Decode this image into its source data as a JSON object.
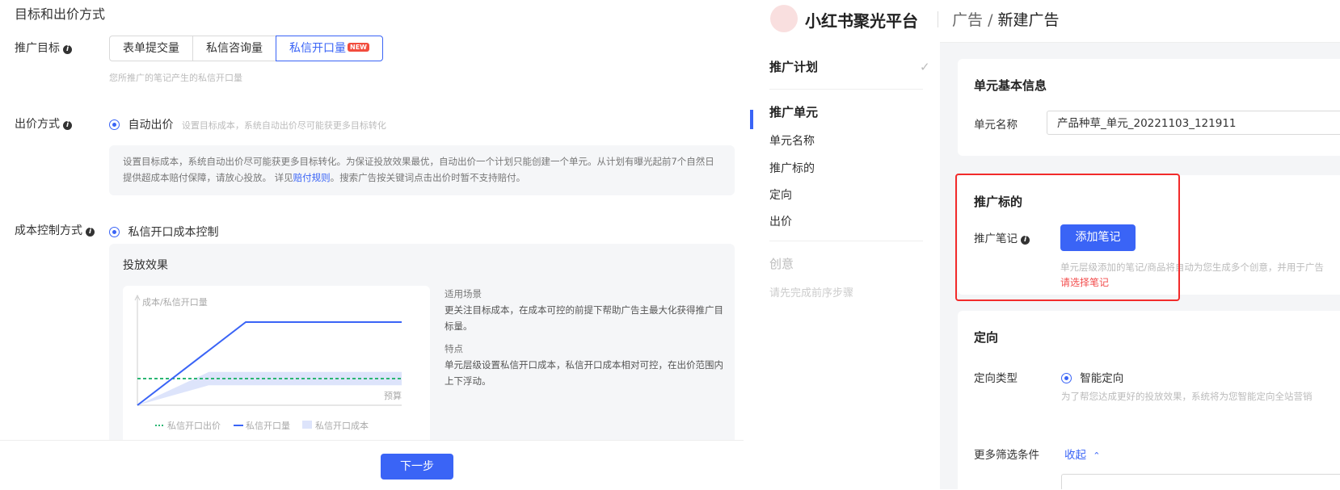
{
  "left": {
    "section_title": "目标和出价方式",
    "goal": {
      "label": "推广目标",
      "tabs": [
        "表单提交量",
        "私信咨询量",
        "私信开口量"
      ],
      "new_badge": "NEW",
      "hint": "您所推广的笔记产生的私信开口量"
    },
    "bid": {
      "label": "出价方式",
      "option": "自动出价",
      "option_hint": "设置目标成本，系统自动出价尽可能获更多目标转化",
      "desc_line1": "设置目标成本，系统自动出价尽可能获更多目标转化。为保证投放效果最优，自动出价一个计划只能创建一个单元。从计划有曝光起前7个自然日",
      "desc_line2_a": "提供超成本赔付保障，请放心投放。 详见",
      "desc_line2_link": "赔付规则",
      "desc_line2_b": "。搜索广告按关键词点击出价时暂不支持赔付。"
    },
    "cost": {
      "label": "成本控制方式",
      "option": "私信开口成本控制",
      "effect_title": "投放效果",
      "y_axis_label": "成本/私信开口量",
      "x_axis_label": "预算",
      "legend": [
        "私信开口出价",
        "私信开口量",
        "私信开口成本"
      ],
      "scene_title": "适用场景",
      "scene_text_1": "更关注目标成本，在成本可控的前提下帮助广告主最大化获得推广目",
      "scene_text_2": "标量。",
      "feature_title": "特点",
      "feature_text_1": "单元层级设置私信开口成本，私信开口成本相对可控，在出价范围内",
      "feature_text_2": "上下浮动。"
    },
    "next_button": "下一步"
  },
  "right": {
    "brand": "小红书聚光平台",
    "crumb_parent": "广告",
    "crumb_sep": "/",
    "crumb_current": "新建广告",
    "nav": {
      "plan": "推广计划",
      "unit": "推广单元",
      "unit_items": [
        "单元名称",
        "推广标的",
        "定向",
        "出价"
      ],
      "creative": "创意",
      "creative_hint": "请先完成前序步骤"
    },
    "basic": {
      "title": "单元基本信息",
      "name_label": "单元名称",
      "name_value": "产品种草_单元_20221103_121911"
    },
    "target": {
      "title": "推广标的",
      "note_label": "推广笔记",
      "add_button": "添加笔记",
      "hint": "单元层级添加的笔记/商品将自动为您生成多个创意，并用于广告",
      "error": "请选择笔记"
    },
    "targeting": {
      "title": "定向",
      "type_label": "定向类型",
      "type_option": "智能定向",
      "type_hint": "为了帮您达成更好的投放效果，系统将为您智能定向全站营销",
      "more_label": "更多筛选条件",
      "collapse": "收起"
    }
  },
  "colors": {
    "accent": "#3a64f6",
    "error": "#f24c4c",
    "highlight_box": "#f22b2b",
    "chart_band": "#dde4fb",
    "bid_line": "#2bb673"
  },
  "chart_data": {
    "type": "line",
    "title": "",
    "xlabel": "预算",
    "ylabel": "成本/私信开口量",
    "series": [
      {
        "name": "私信开口量",
        "x": [
          0,
          0.41,
          1
        ],
        "y": [
          0,
          1,
          1
        ]
      },
      {
        "name": "私信开口出价",
        "x": [
          0,
          1
        ],
        "y": [
          0.32,
          0.32
        ]
      },
      {
        "name": "私信开口成本",
        "x": [
          0,
          0.27,
          1
        ],
        "y_low": [
          0,
          0.24,
          0.24
        ],
        "y_high": [
          0,
          0.4,
          0.4
        ]
      }
    ],
    "grid": false,
    "legend_position": "bottom"
  }
}
